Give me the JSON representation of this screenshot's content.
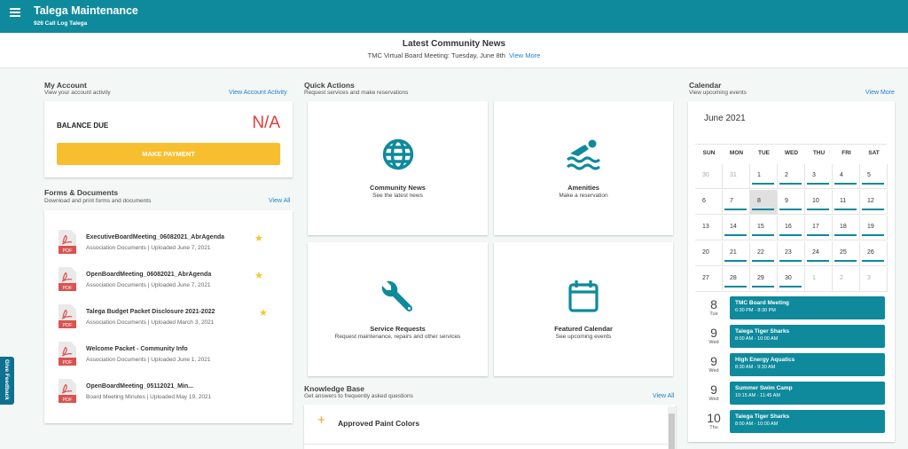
{
  "header": {
    "title": "Talega Maintenance",
    "subtitle": "926 Call Log Talega"
  },
  "news": {
    "title": "Latest Community News",
    "line": "TMC Virtual Board Meeting: Tuesday, June 8th",
    "link": "View More"
  },
  "account": {
    "title": "My Account",
    "subtitle": "View your account activity",
    "link": "View Account Activity",
    "balance_label": "BALANCE DUE",
    "balance_value": "N/A",
    "pay_button": "MAKE PAYMENT"
  },
  "forms": {
    "title": "Forms & Documents",
    "subtitle": "Download and print forms and documents",
    "link": "View All",
    "pdf_badge": "PDF",
    "items": [
      {
        "name": "ExecutiveBoardMeeting_06082021_AbrAgenda",
        "meta": "Association Documents | Uploaded June 7, 2021",
        "starred": true
      },
      {
        "name": "OpenBoardMeeting_06082021_AbrAgenda",
        "meta": "Association Documents | Uploaded June 7, 2021",
        "starred": true
      },
      {
        "name": "Talega Budget Packet Disclosure 2021-2022",
        "meta": "Association Documents | Uploaded March 3, 2021",
        "starred": true
      },
      {
        "name": "Welcome Packet - Community Info",
        "meta": "Association Documents | Uploaded June 1, 2021",
        "starred": false
      },
      {
        "name": "OpenBoardMeeting_05112021_Min...",
        "meta": "Board Meeting Minutes | Uploaded May 19, 2021",
        "starred": false
      }
    ]
  },
  "quick_actions": {
    "title": "Quick Actions",
    "subtitle": "Request services and make reservations",
    "items": [
      {
        "label": "Community News",
        "sub": "See the latest news",
        "icon": "globe-icon"
      },
      {
        "label": "Amenities",
        "sub": "Make a reservation",
        "icon": "swimmer-icon"
      },
      {
        "label": "Service Requests",
        "sub": "Request maintenance, repairs and other services",
        "icon": "wrench-icon"
      },
      {
        "label": "Featured Calendar",
        "sub": "See upcoming events",
        "icon": "calendar-icon"
      }
    ]
  },
  "knowledge": {
    "title": "Knowledge Base",
    "subtitle": "Get answers to frequently asked questions",
    "link": "View All",
    "item": "Approved Paint Colors"
  },
  "calendar": {
    "title": "Calendar",
    "subtitle": "View upcoming events",
    "link": "View More",
    "month": "June 2021",
    "weekdays": [
      "SUN",
      "MON",
      "TUE",
      "WED",
      "THU",
      "FRI",
      "SAT"
    ],
    "weeks": [
      [
        "30",
        "31",
        "1",
        "2",
        "3",
        "4",
        "5"
      ],
      [
        "6",
        "7",
        "8",
        "9",
        "10",
        "11",
        "12"
      ],
      [
        "13",
        "14",
        "15",
        "16",
        "17",
        "18",
        "19"
      ],
      [
        "20",
        "21",
        "22",
        "23",
        "24",
        "25",
        "26"
      ],
      [
        "27",
        "28",
        "29",
        "30",
        "1",
        "2",
        "3"
      ]
    ],
    "muted": [
      [
        0,
        0
      ],
      [
        0,
        1
      ],
      [
        4,
        4
      ],
      [
        4,
        5
      ],
      [
        4,
        6
      ]
    ],
    "today": [
      1,
      2
    ],
    "no_event": [
      [
        1,
        0
      ],
      [
        2,
        0
      ],
      [
        3,
        0
      ],
      [
        4,
        0
      ],
      [
        0,
        0
      ],
      [
        0,
        1
      ],
      [
        4,
        4
      ],
      [
        4,
        5
      ],
      [
        4,
        6
      ]
    ],
    "events": [
      {
        "day": "8",
        "dow": "Tue",
        "name": "TMC Board Meeting",
        "time": "6:30 PM - 8:30 PM"
      },
      {
        "day": "9",
        "dow": "Wed",
        "name": "Talega Tiger Sharks",
        "time": "8:00 AM - 10:00 AM"
      },
      {
        "day": "9",
        "dow": "Wed",
        "name": "High Energy Aquatics",
        "time": "8:30 AM - 9:30 AM"
      },
      {
        "day": "9",
        "dow": "Wed",
        "name": "Summer Swim Camp",
        "time": "10:15 AM - 11:45 AM"
      },
      {
        "day": "10",
        "dow": "Thu",
        "name": "Talega Tiger Sharks",
        "time": "8:00 AM - 10:00 AM"
      }
    ]
  },
  "feedback": {
    "label": "Give Feedback"
  },
  "colors": {
    "brand": "#0e8a9c",
    "accent": "#f7bf30",
    "balance": "#e33b3b",
    "link": "#1f7fcf"
  }
}
